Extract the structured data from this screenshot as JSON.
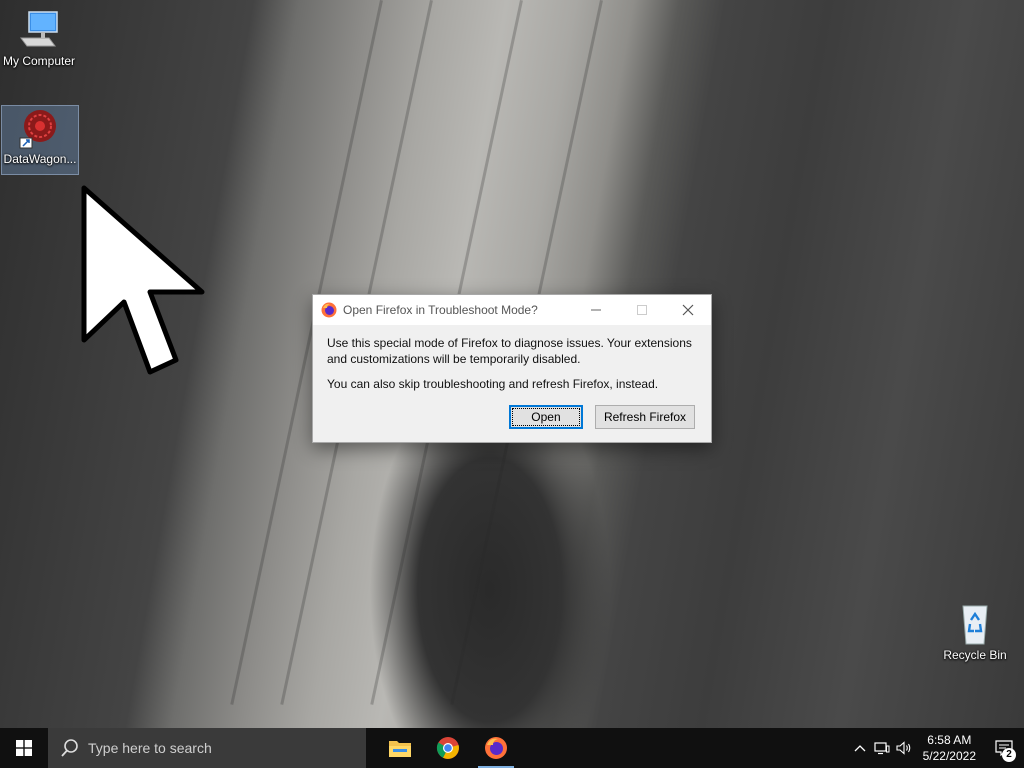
{
  "desktop": {
    "icons": [
      {
        "label": "My Computer",
        "icon": "computer-icon"
      },
      {
        "label": "DataWagon...",
        "icon": "datawagon-icon"
      },
      {
        "label": "Recycle Bin",
        "icon": "recycle-bin-icon"
      }
    ]
  },
  "dialog": {
    "title": "Open Firefox in Troubleshoot Mode?",
    "message1": "Use this special mode of Firefox to diagnose issues. Your extensions and customizations will be temporarily disabled.",
    "message2": "You can also skip troubleshooting and refresh Firefox, instead.",
    "buttons": {
      "open": "Open",
      "refresh": "Refresh Firefox"
    }
  },
  "taskbar": {
    "search_placeholder": "Type here to search",
    "pinned": [
      "file-explorer-icon",
      "chrome-icon",
      "firefox-icon"
    ],
    "clock": {
      "time": "6:58 AM",
      "date": "5/22/2022"
    },
    "notifications_count": "2"
  },
  "colors": {
    "accent": "#0078d7",
    "taskbar": "#101010"
  }
}
